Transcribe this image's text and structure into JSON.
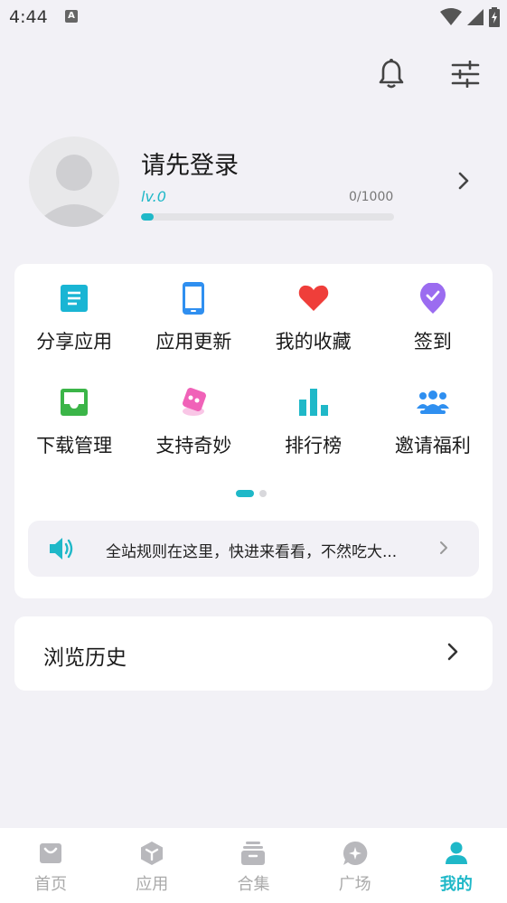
{
  "status_bar": {
    "time": "4:44",
    "notification_badge": "A"
  },
  "header": {
    "bell_icon": "bell-icon",
    "settings_icon": "sliders-icon"
  },
  "profile": {
    "name": "请先登录",
    "level": "lv.0",
    "exp_text": "0/1000",
    "exp_progress": 0.05
  },
  "features": [
    {
      "label": "分享应用",
      "icon": "document-icon",
      "color": "#19b5d4"
    },
    {
      "label": "应用更新",
      "icon": "phone-icon",
      "color": "#2f8ff0"
    },
    {
      "label": "我的收藏",
      "icon": "heart-icon",
      "color": "#ef3e3a"
    },
    {
      "label": "签到",
      "icon": "check-badge-icon",
      "color": "#9b6cf0"
    },
    {
      "label": "下载管理",
      "icon": "inbox-icon",
      "color": "#3bb548"
    },
    {
      "label": "支持奇妙",
      "icon": "gift-icon",
      "color": "#f062b8"
    },
    {
      "label": "排行榜",
      "icon": "bar-chart-icon",
      "color": "#1fb8c8"
    },
    {
      "label": "邀请福利",
      "icon": "group-icon",
      "color": "#2f8ff0"
    }
  ],
  "pager": {
    "pages": 2,
    "active": 0
  },
  "notice": {
    "text": "全站规则在这里，快进来看看，不然吃大..."
  },
  "history": {
    "label": "浏览历史"
  },
  "tabs": [
    {
      "label": "首页",
      "icon": "home-bag-icon",
      "active": false
    },
    {
      "label": "应用",
      "icon": "cube-icon",
      "active": false
    },
    {
      "label": "合集",
      "icon": "archive-icon",
      "active": false
    },
    {
      "label": "广场",
      "icon": "chat-bubble-icon",
      "active": false
    },
    {
      "label": "我的",
      "icon": "person-icon",
      "active": true
    }
  ],
  "colors": {
    "accent": "#1fb8c8",
    "background": "#f2f1f6"
  }
}
